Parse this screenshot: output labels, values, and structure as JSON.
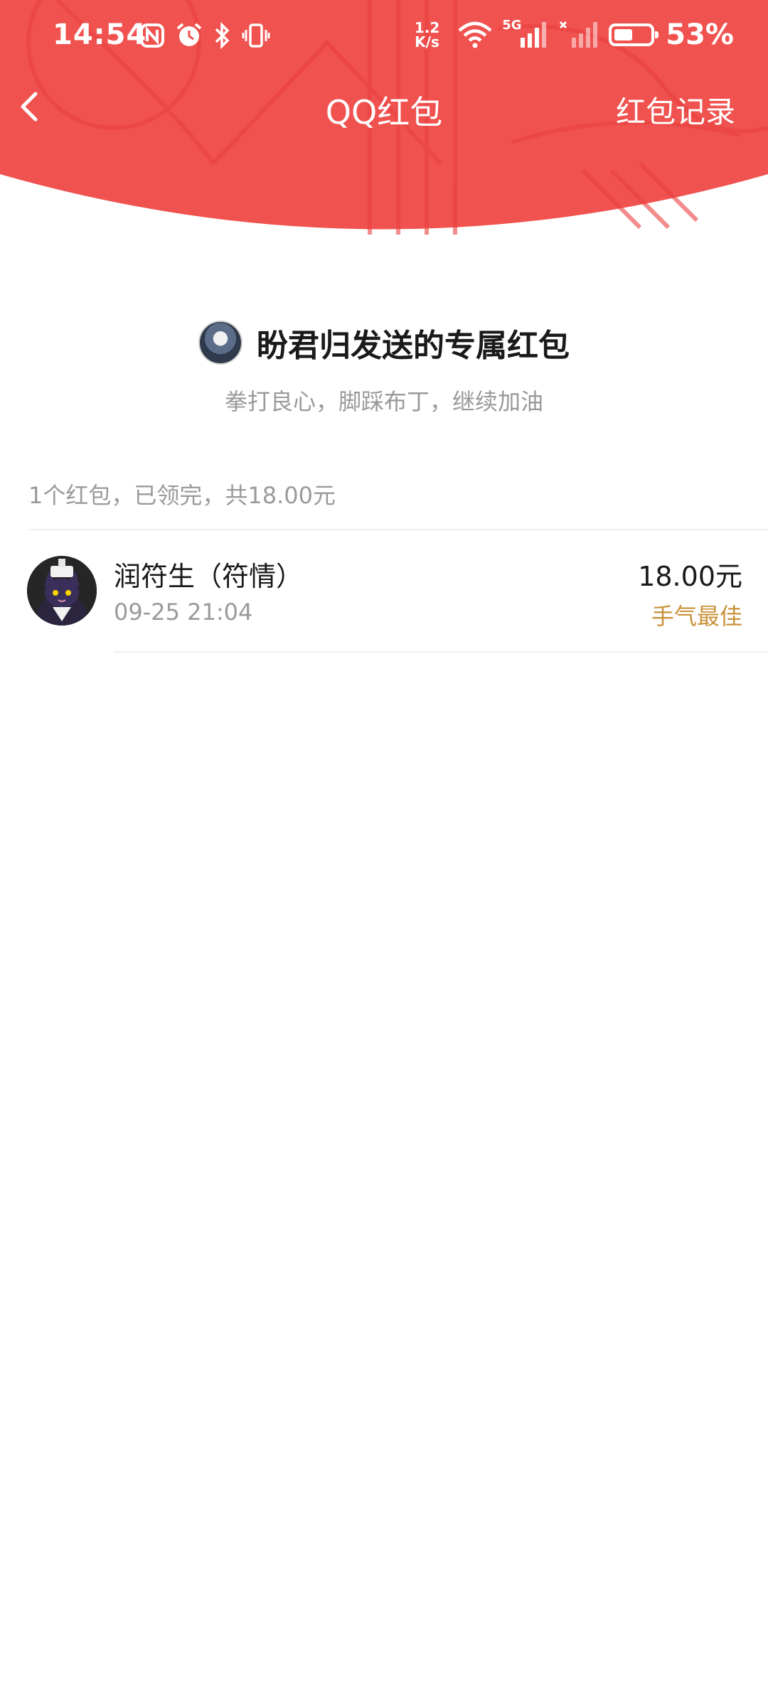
{
  "status_bar": {
    "time": "14:54",
    "net_speed_value": "1.2",
    "net_speed_unit": "K/s",
    "network_type": "5G",
    "battery_percent": "53%",
    "battery_level": 0.53
  },
  "nav": {
    "title": "QQ红包",
    "right_link": "红包记录"
  },
  "colors": {
    "header_red": "#f0524f",
    "gold": "#c9923a"
  },
  "sender": {
    "title": "盼君归发送的专属红包",
    "wish": "拳打良心，脚踩布丁，继续加油"
  },
  "summary": "1个红包，已领完，共18.00元",
  "records": [
    {
      "name": "润符生（符情）",
      "time": "09-25 21:04",
      "amount": "18.00元",
      "badge": "手气最佳"
    }
  ]
}
